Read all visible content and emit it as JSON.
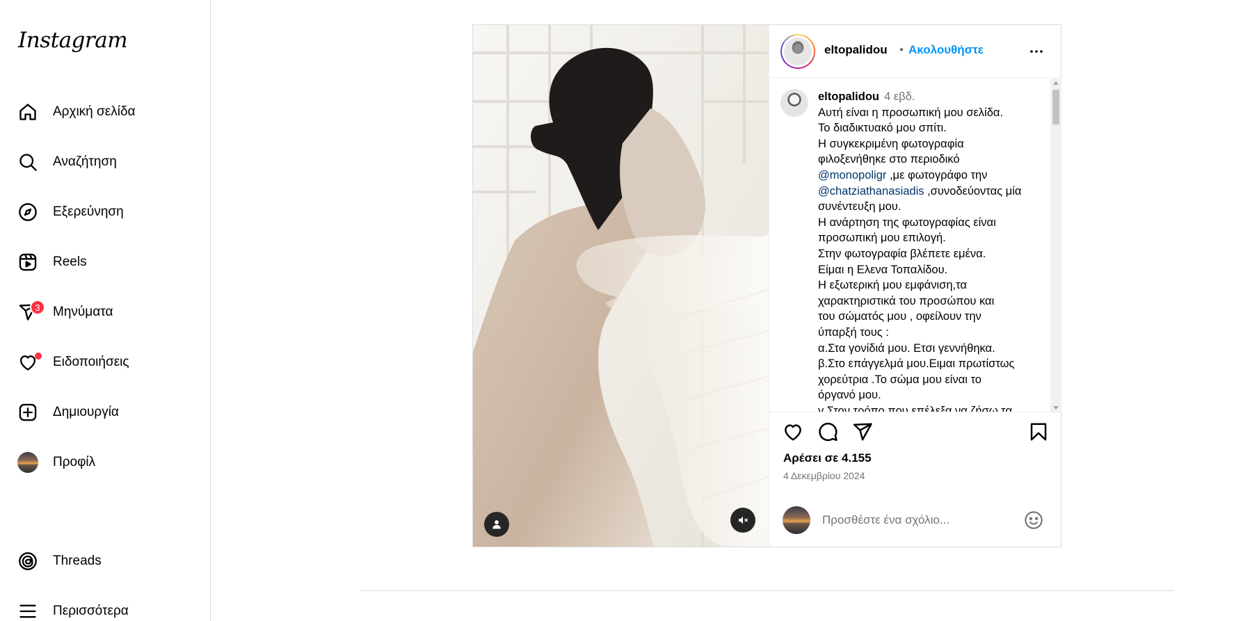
{
  "app": {
    "logo": "Instagram"
  },
  "sidebar": {
    "items": [
      {
        "label": "Αρχική σελίδα",
        "icon": "home-icon"
      },
      {
        "label": "Αναζήτηση",
        "icon": "search-icon"
      },
      {
        "label": "Εξερεύνηση",
        "icon": "compass-icon"
      },
      {
        "label": "Reels",
        "icon": "reels-icon"
      },
      {
        "label": "Μηνύματα",
        "icon": "messenger-icon",
        "badge": "3"
      },
      {
        "label": "Ειδοποιήσεις",
        "icon": "heart-icon"
      },
      {
        "label": "Δημιουργία",
        "icon": "plus-square-icon"
      },
      {
        "label": "Προφίλ",
        "icon": "profile-avatar"
      }
    ],
    "bottom": [
      {
        "label": "Threads",
        "icon": "threads-icon"
      },
      {
        "label": "Περισσότερα",
        "icon": "menu-icon"
      }
    ]
  },
  "post": {
    "username": "eltopalidou",
    "separator": "•",
    "follow_label": "Ακολουθήστε",
    "caption": {
      "username": "eltopalidou",
      "time": "4 εβδ.",
      "lines": [
        "Αυτή είναι η προσωπική μου σελίδα.",
        "Το διαδικτυακό μου σπίτι.",
        "Η συγκεκριμένη φωτογραφία",
        "φιλοξενήθηκε στο περιοδικό",
        "",
        "",
        "συνέντευξη μου.",
        "Η ανάρτηση της φωτογραφίας είναι",
        "προσωπική μου επιλογή.",
        "Στην φωτογραφία βλέπετε εμένα.",
        "Είμαι η Ελενα Τοπαλίδου.",
        "Η εξωτερική μου εμφάνιση,τα",
        "χαρακτηριστικά του προσώπου και",
        "του σώματός μου , οφείλουν την",
        "ύπαρξή τους :",
        "α.Στα γονίδιά μου. Ετσι γεννήθηκα.",
        "β.Στο επάγγελμά μου.Ειμαι πρωτίστως",
        "χορεύτρια .Το σώμα μου είναι το",
        "όργανό μου.",
        "γ.Στον τρόπο που επέλεξα να ζήσω τα"
      ],
      "mention_1": "@monopoligr",
      "mention_1_suffix": " ,με φωτογράφο την",
      "mention_2": "@chatziathanasiadis",
      "mention_2_suffix": " ,συνοδεύοντας μία"
    },
    "likes": "Αρέσει σε 4.155",
    "date": "4 Δεκεμβρίου 2024",
    "comment_placeholder": "Προσθέστε ένα σχόλιο...",
    "media": {
      "muted": true
    }
  }
}
